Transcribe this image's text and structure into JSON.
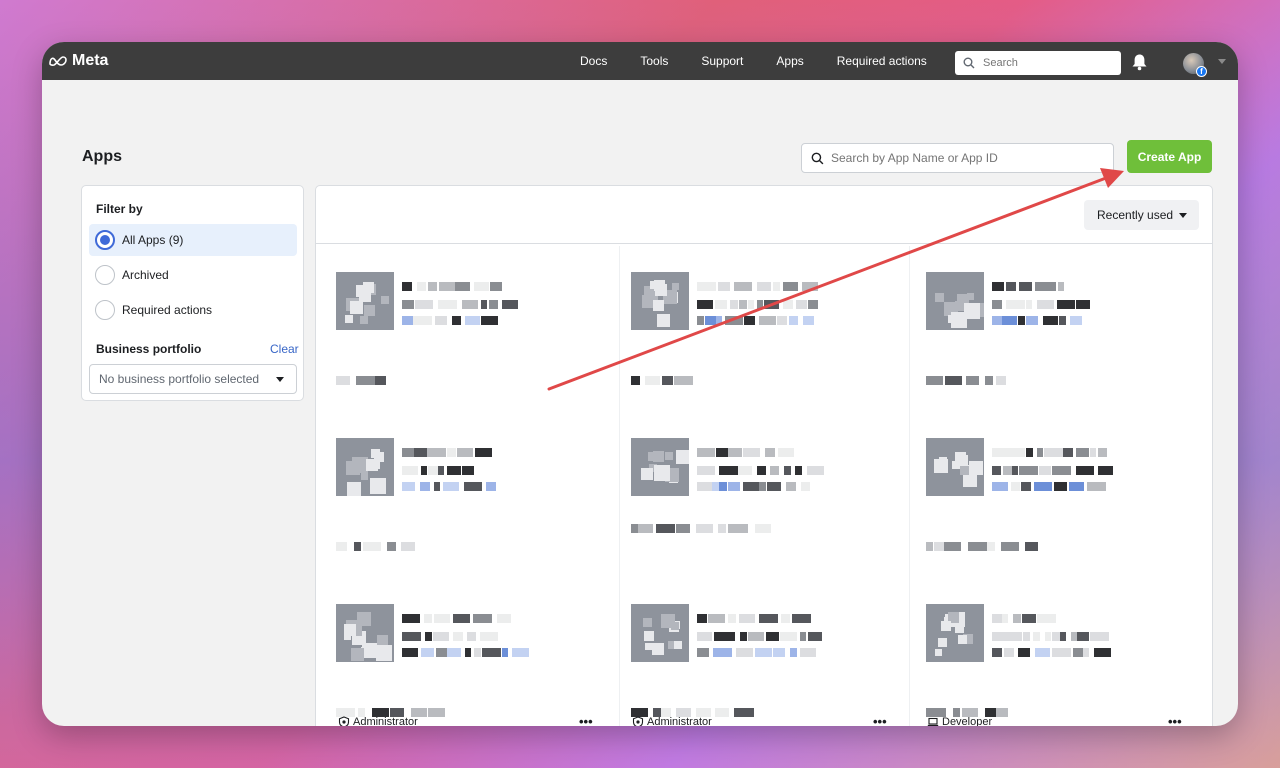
{
  "topbar": {
    "brand": "Meta",
    "nav": [
      "Docs",
      "Tools",
      "Support",
      "Apps",
      "Required actions"
    ],
    "search_placeholder": "Search"
  },
  "page": {
    "title": "Apps",
    "search_placeholder": "Search by App Name or App ID",
    "create_label": "Create App"
  },
  "filter": {
    "title": "Filter by",
    "options": [
      {
        "label": "All Apps (9)",
        "selected": true
      },
      {
        "label": "Archived",
        "selected": false
      },
      {
        "label": "Required actions",
        "selected": false
      }
    ],
    "portfolio_label": "Business portfolio",
    "clear_label": "Clear",
    "portfolio_value": "No business portfolio selected"
  },
  "apps": {
    "sort_label": "Recently used",
    "footers": [
      {
        "role": "Administrator",
        "more": "•••"
      },
      {
        "role": "Administrator",
        "more": "•••"
      },
      {
        "role": "Developer",
        "more": "•••"
      }
    ]
  },
  "colors": {
    "topbar": "#3d3d3d",
    "create_button": "#6fbf3a",
    "accent_blue": "#3f6ad8",
    "annotation_arrow": "#e04848"
  }
}
